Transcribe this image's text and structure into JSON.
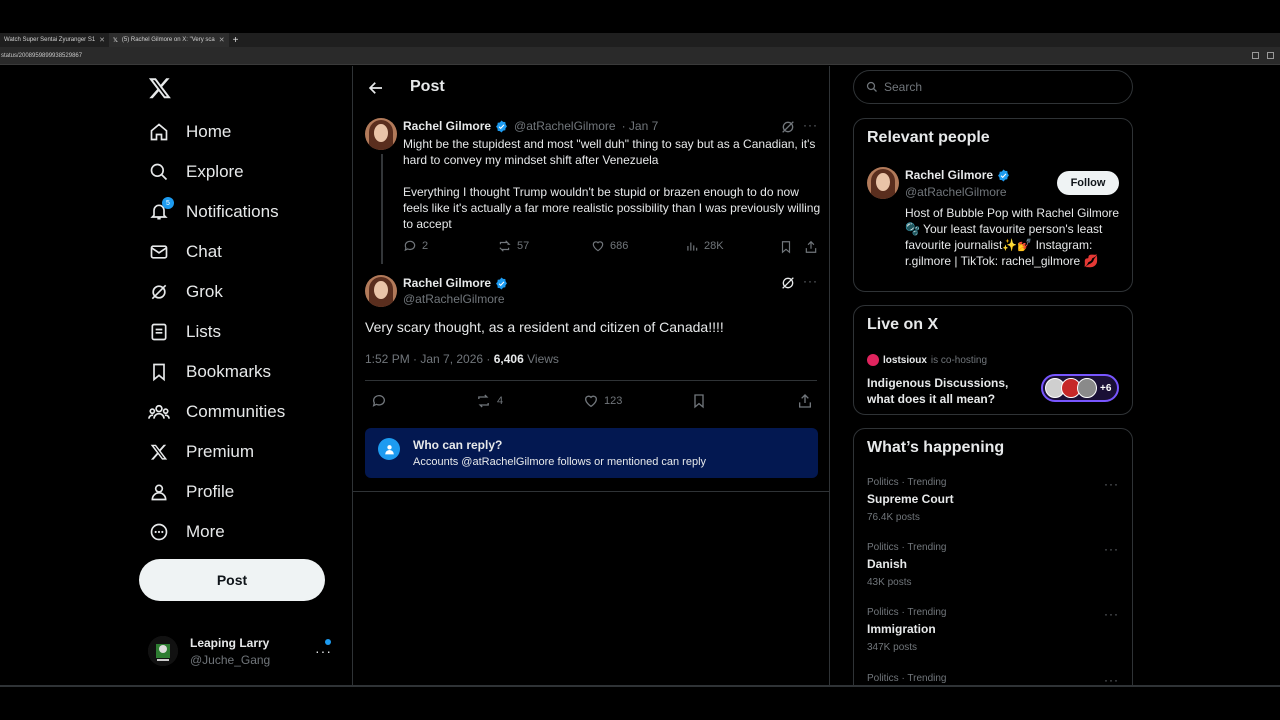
{
  "browser": {
    "tabs": [
      {
        "label": "Watch Super Sentai Zyuranger S1"
      },
      {
        "label": "(5) Rachel Gilmore on X: \"Very sca"
      }
    ],
    "url": "status/2008959899938529867"
  },
  "nav": {
    "items": [
      {
        "label": "Home",
        "icon": "home-icon"
      },
      {
        "label": "Explore",
        "icon": "search-icon"
      },
      {
        "label": "Notifications",
        "icon": "bell-icon",
        "badge": "5"
      },
      {
        "label": "Chat",
        "icon": "mail-icon"
      },
      {
        "label": "Grok",
        "icon": "grok-icon"
      },
      {
        "label": "Lists",
        "icon": "list-icon"
      },
      {
        "label": "Bookmarks",
        "icon": "bookmark-icon"
      },
      {
        "label": "Communities",
        "icon": "communities-icon"
      },
      {
        "label": "Premium",
        "icon": "x-logo-icon"
      },
      {
        "label": "Profile",
        "icon": "profile-icon"
      },
      {
        "label": "More",
        "icon": "more-circle-icon"
      }
    ],
    "post_label": "Post",
    "account": {
      "name": "Leaping Larry",
      "handle": "@Juche_Gang"
    }
  },
  "main": {
    "title": "Post",
    "parent_tweet": {
      "name": "Rachel Gilmore",
      "handle": "@atRachelGilmore",
      "date": "· Jan 7",
      "text": "Might be the stupidest and most \"well duh\" thing to say but as a Canadian, it's hard to convey my mindset shift after Venezuela\n\nEverything I thought Trump wouldn't be stupid or brazen enough to do now feels like it's actually a far more realistic possibility than I was previously willing to accept",
      "replies": "2",
      "reposts": "57",
      "likes": "686",
      "views": "28K"
    },
    "tweet": {
      "name": "Rachel Gilmore",
      "handle": "@atRachelGilmore",
      "text": "Very scary thought, as a resident and citizen of Canada!!!!",
      "timestamp": "1:52 PM · Jan 7, 2026 · ",
      "views_count": "6,406",
      "views_label": " Views",
      "reposts": "4",
      "likes": "123"
    },
    "reply_restriction": {
      "title": "Who can reply?",
      "text": "Accounts @atRachelGilmore follows or mentioned can reply"
    }
  },
  "sidebar": {
    "search_placeholder": "Search",
    "relevant": {
      "heading": "Relevant people",
      "name": "Rachel Gilmore",
      "handle": "@atRachelGilmore",
      "follow_label": "Follow",
      "bio": "Host of Bubble Pop with Rachel Gilmore 🫧 Your least favourite person's least favourite journalist✨💅 Instagram: r.gilmore | TikTok: rachel_gilmore 💋"
    },
    "live": {
      "heading": "Live on X",
      "host": "lostsioux",
      "host_suffix": " is co-hosting",
      "title": "Indigenous Discussions, what does it all mean?",
      "extra": "+6"
    },
    "happening": {
      "heading": "What’s happening",
      "trends": [
        {
          "context": "Politics · Trending",
          "name": "Supreme Court",
          "count": "76.4K posts"
        },
        {
          "context": "Politics · Trending",
          "name": "Danish",
          "count": "43K posts"
        },
        {
          "context": "Politics · Trending",
          "name": "Immigration",
          "count": "347K posts"
        },
        {
          "context": "Politics · Trending",
          "name": "",
          "count": ""
        }
      ]
    }
  },
  "colors": {
    "accent": "#1d9bf0",
    "background": "#000000",
    "border": "#2f3336",
    "muted": "#71767b",
    "reply_box": "#031851"
  }
}
